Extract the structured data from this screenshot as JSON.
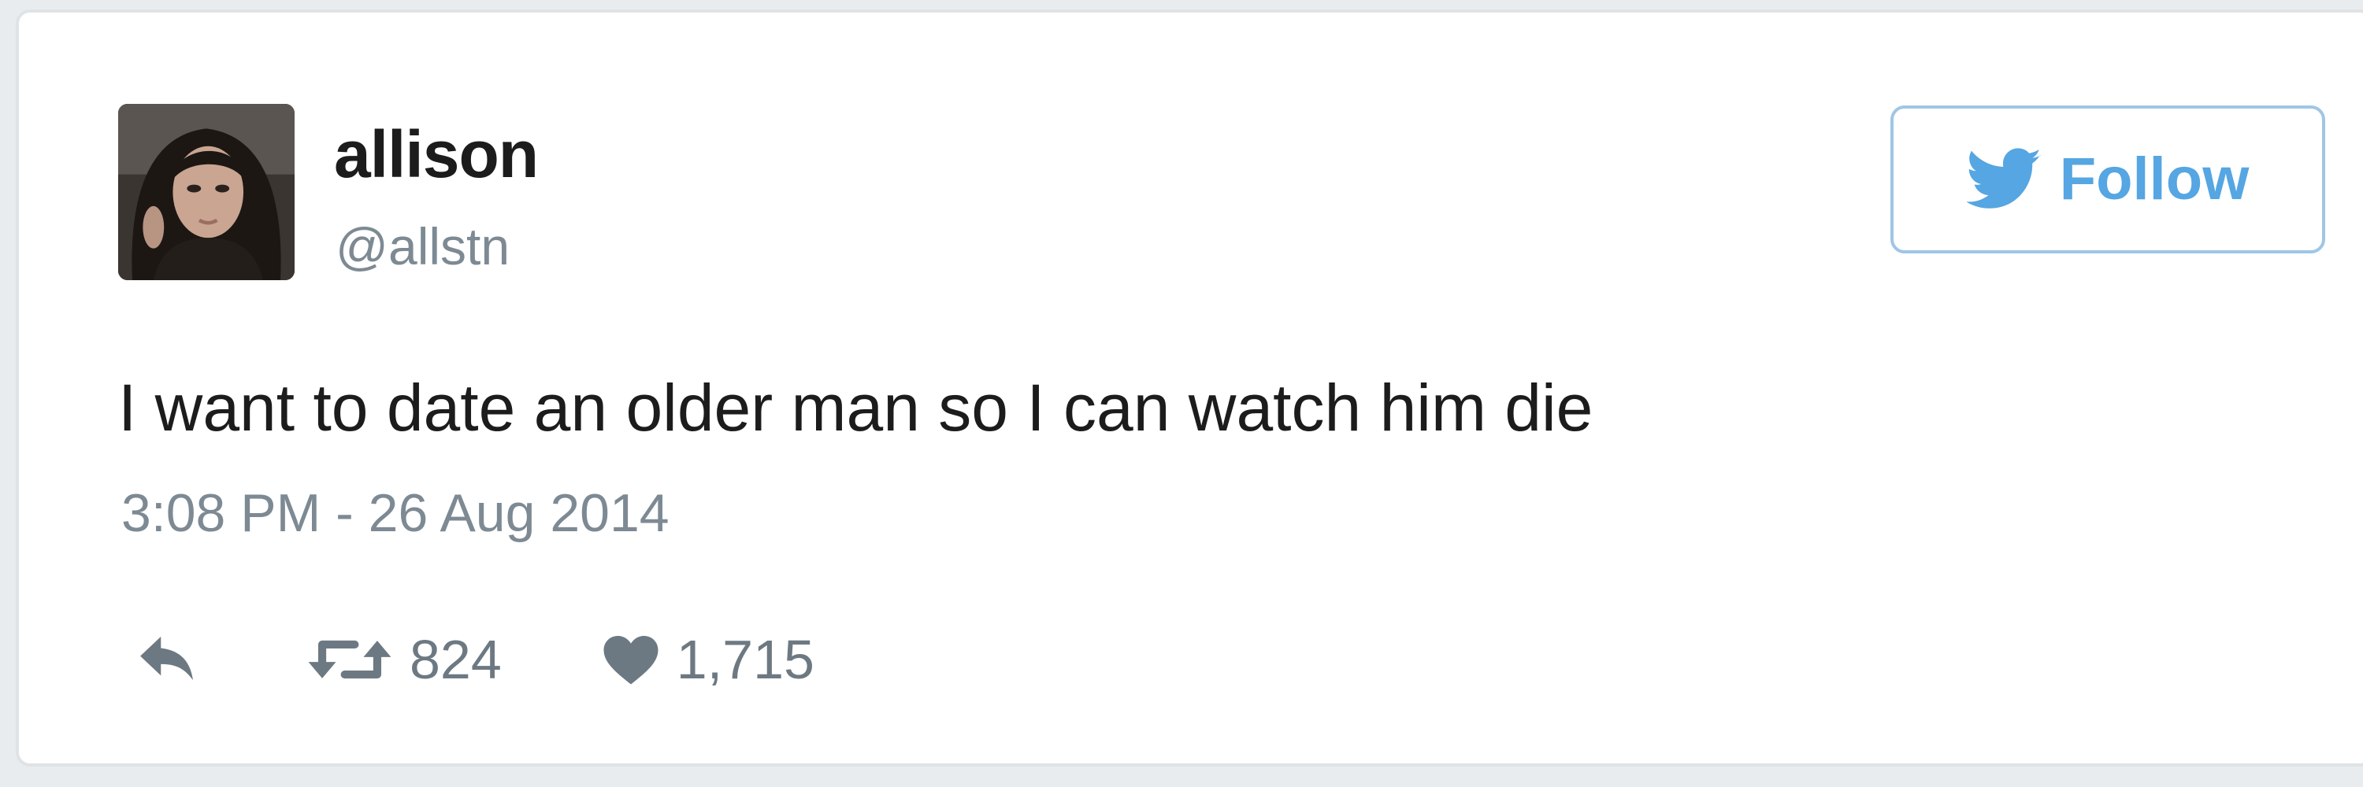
{
  "tweet": {
    "user": {
      "display_name": "allison",
      "handle": "@allstn"
    },
    "follow_label": "Follow",
    "text": "I want to date an older man so I can watch him die",
    "timestamp": "3:08 PM - 26 Aug 2014",
    "retweet_count": "824",
    "like_count": "1,715"
  },
  "icons": {
    "follow": "twitter-bird-icon",
    "reply": "reply-icon",
    "retweet": "retweet-icon",
    "like": "heart-icon"
  },
  "colors": {
    "accent": "#55a6e2",
    "follow_border": "#9fc6e6",
    "muted_text": "#7d8a94",
    "icon_gray": "#6d7982",
    "body_text": "#1c1c1c"
  }
}
